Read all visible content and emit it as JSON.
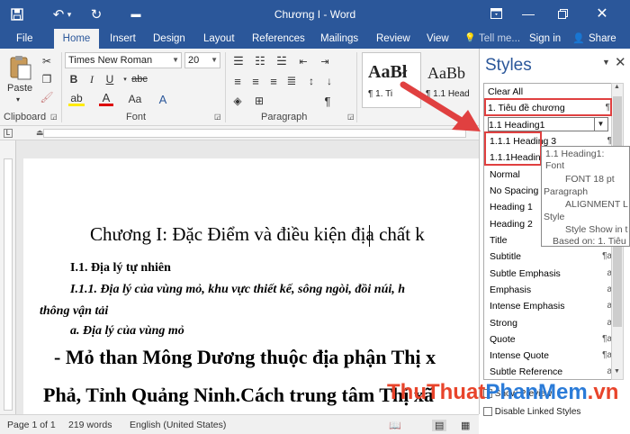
{
  "titlebar": {
    "title": "Chương I - Word",
    "bg": "#2b579a"
  },
  "tabs": {
    "file": "File",
    "home": "Home",
    "insert": "Insert",
    "design": "Design",
    "layout": "Layout",
    "references": "References",
    "mailings": "Mailings",
    "review": "Review",
    "view": "View",
    "tellme": "Tell me...",
    "signin": "Sign in",
    "share": "Share"
  },
  "ribbon": {
    "paste": "Paste",
    "clipboard": "Clipboard",
    "font": "Font",
    "paragraph": "Paragraph",
    "font_name": "Times New Roman",
    "font_size": "20",
    "style_preview_1": "AaBł",
    "style_preview_1_label": "¶ 1. Ti",
    "style_preview_2": "AaBb",
    "style_preview_2_label": "¶ 1.1 Head"
  },
  "document": {
    "line1": "Chương I: Đặc Điểm và điều kiện địa chất k",
    "line2": "I.1. Địa lý tự  nhiên",
    "line3": "I.1.1. Địa lý của vùng mỏ, khu vực thiết kế, sông ngòi, đồi núi, h",
    "line4": "thông vận tải",
    "line5": "a. Địa lý của vùng mỏ",
    "line6": "- Mỏ than Mông Dương thuộc địa phận Thị x",
    "line7": "Phả, Tỉnh Quảng Ninh.Cách trung tâm Thị xã"
  },
  "styles_pane": {
    "title": "Styles",
    "items": [
      {
        "label": "Clear All",
        "mark": ""
      },
      {
        "label": "1. Tiêu đề chương",
        "mark": "¶"
      },
      {
        "label": "1.1 Heading1",
        "mark": ""
      },
      {
        "label": "1.1.1 Heading 3",
        "mark": "¶"
      },
      {
        "label": "1.1.1Headin",
        "mark": ""
      },
      {
        "label": "Normal",
        "mark": ""
      },
      {
        "label": "No Spacing",
        "mark": ""
      },
      {
        "label": "Heading 1",
        "mark": ""
      },
      {
        "label": "Heading 2",
        "mark": ""
      },
      {
        "label": "Title",
        "mark": ""
      },
      {
        "label": "Subtitle",
        "mark": "¶a"
      },
      {
        "label": "Subtle Emphasis",
        "mark": "a"
      },
      {
        "label": "Emphasis",
        "mark": "a"
      },
      {
        "label": "Intense Emphasis",
        "mark": "a"
      },
      {
        "label": "Strong",
        "mark": "a"
      },
      {
        "label": "Quote",
        "mark": "¶a"
      },
      {
        "label": "Intense Quote",
        "mark": "¶a"
      },
      {
        "label": "Subtle Reference",
        "mark": "a"
      }
    ],
    "show_preview": "Show Preview",
    "disable_linked": "Disable Linked Styles"
  },
  "tooltip": {
    "line1": "1.1 Heading1:",
    "line2": "Font",
    "line3": "FONT  18 pt",
    "line4": "Paragraph",
    "line5": "ALIGNMENT  L",
    "line6": "Style",
    "line7": "Style Show in t",
    "line8": "Based on: 1. Tiêu"
  },
  "status": {
    "page": "Page 1 of 1",
    "words": "219 words",
    "language": "English (United States)"
  },
  "watermark": {
    "part1": "ThuThuat",
    "part2": "PhanMem",
    "part3": ".vn",
    "color1": "#e8442b",
    "color2": "#2a7bd8"
  },
  "colors": {
    "accent": "#2b579a",
    "highlight_box": "#e04040",
    "arrow": "#e04040"
  }
}
